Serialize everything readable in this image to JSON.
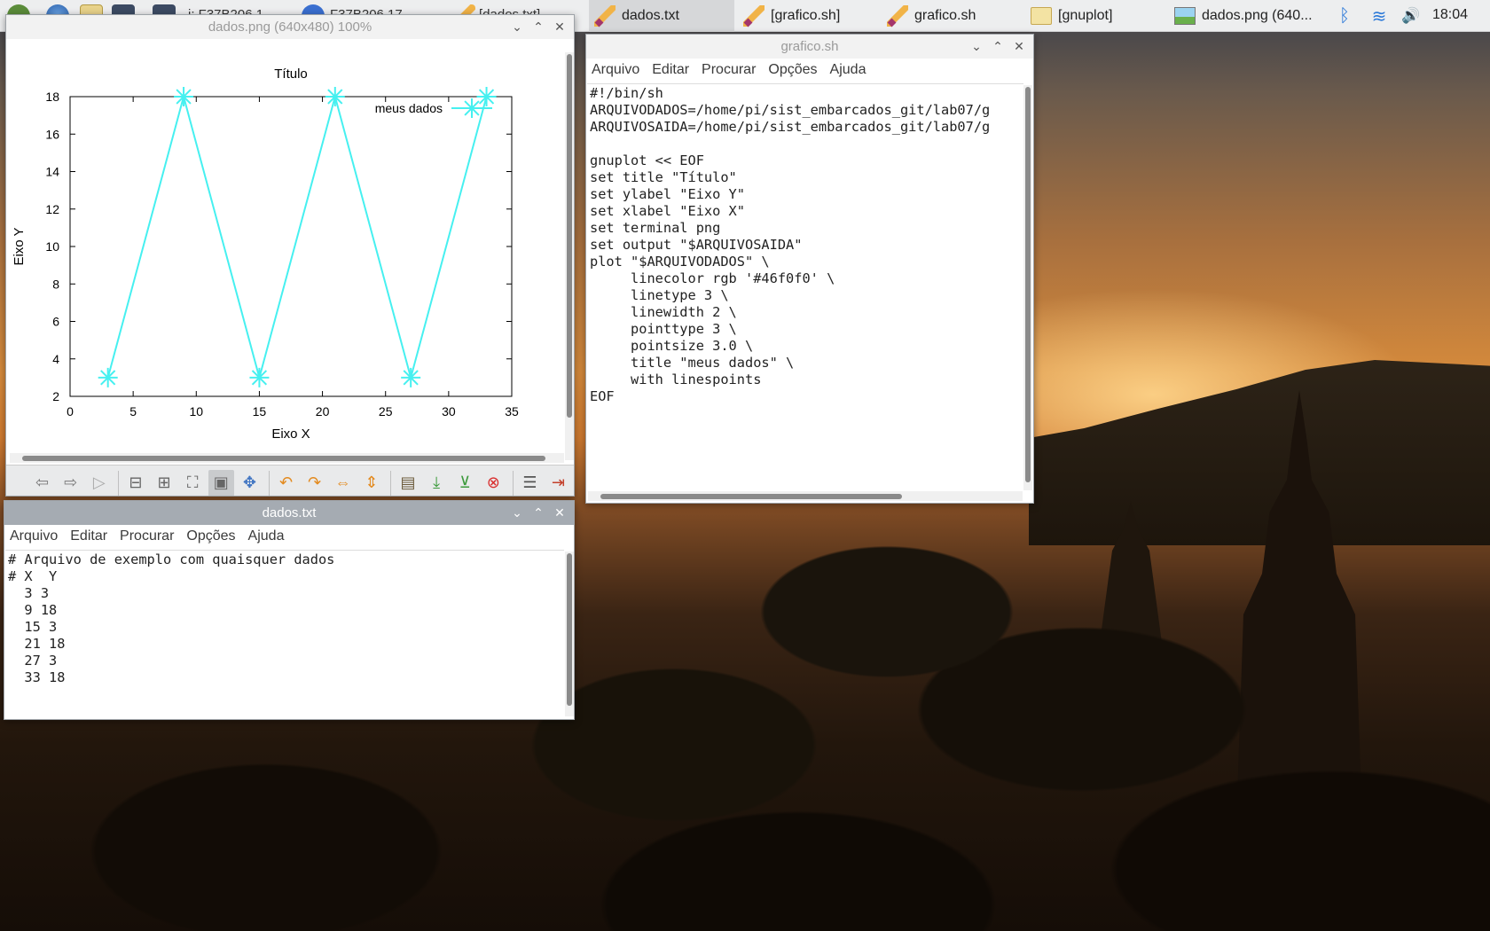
{
  "taskbar": {
    "left_titles": [
      "j: F37B206 1",
      "F37B206 17",
      "[dados.txt]"
    ],
    "tasks": [
      {
        "label": "dados.txt",
        "icon": "pencil-icon"
      },
      {
        "label": "[grafico.sh]",
        "icon": "pencil-icon"
      },
      {
        "label": "grafico.sh",
        "icon": "pencil-icon"
      },
      {
        "label": "[gnuplot]",
        "icon": "folder-icon"
      },
      {
        "label": "dados.png (640...",
        "icon": "image-icon"
      }
    ],
    "tray": {
      "bluetooth": "ᛒ",
      "wifi": "≋",
      "volume": "🔊"
    },
    "clock": "18:04"
  },
  "image_window": {
    "title": "dados.png (640x480) 100%",
    "toolbar_icons": [
      "back-icon",
      "forward-icon",
      "play-icon",
      "zoom-out-icon",
      "zoom-in-icon",
      "fit-icon",
      "original-size-icon",
      "fullscreen-icon",
      "rotate-ccw-icon",
      "rotate-cw-icon",
      "flip-h-icon",
      "flip-v-icon",
      "open-icon",
      "save-icon",
      "save-as-icon",
      "delete-icon",
      "preferences-icon",
      "quit-icon"
    ]
  },
  "chart_data": {
    "type": "line",
    "title": "Título",
    "xlabel": "Eixo X",
    "ylabel": "Eixo Y",
    "x": [
      3,
      9,
      15,
      21,
      27,
      33
    ],
    "series": [
      {
        "name": "meus dados",
        "values": [
          3,
          18,
          3,
          18,
          3,
          18
        ],
        "color": "#46f0f0"
      }
    ],
    "xlim": [
      0,
      35
    ],
    "ylim": [
      2,
      18
    ],
    "xticks": [
      "0",
      "5",
      "10",
      "15",
      "20",
      "25",
      "30",
      "35"
    ],
    "yticks": [
      "2",
      "4",
      "6",
      "8",
      "10",
      "12",
      "14",
      "16",
      "18"
    ],
    "legend_position": "top-right",
    "grid": false
  },
  "script_window": {
    "title": "grafico.sh",
    "menu": [
      "Arquivo",
      "Editar",
      "Procurar",
      "Opções",
      "Ajuda"
    ],
    "lines": [
      "#!/bin/sh",
      "ARQUIVODADOS=/home/pi/sist_embarcados_git/lab07/g",
      "ARQUIVOSAIDA=/home/pi/sist_embarcados_git/lab07/g",
      "",
      "gnuplot << EOF",
      "set title \"Título\"",
      "set ylabel \"Eixo Y\"",
      "set xlabel \"Eixo X\"",
      "set terminal png",
      "set output \"$ARQUIVOSAIDA\"",
      "plot \"$ARQUIVODADOS\" \\",
      "     linecolor rgb '#46f0f0' \\",
      "     linetype 3 \\",
      "     linewidth 2 \\",
      "     pointtype 3 \\",
      "     pointsize 3.0 \\",
      "     title \"meus dados\" \\",
      "     with linespoints",
      "EOF"
    ]
  },
  "data_window": {
    "title": "dados.txt",
    "menu": [
      "Arquivo",
      "Editar",
      "Procurar",
      "Opções",
      "Ajuda"
    ],
    "lines": [
      "# Arquivo de exemplo com quaisquer dados",
      "# X  Y",
      "  3 3",
      "  9 18",
      "  15 3",
      "  21 18",
      "  27 3",
      "  33 18"
    ]
  }
}
